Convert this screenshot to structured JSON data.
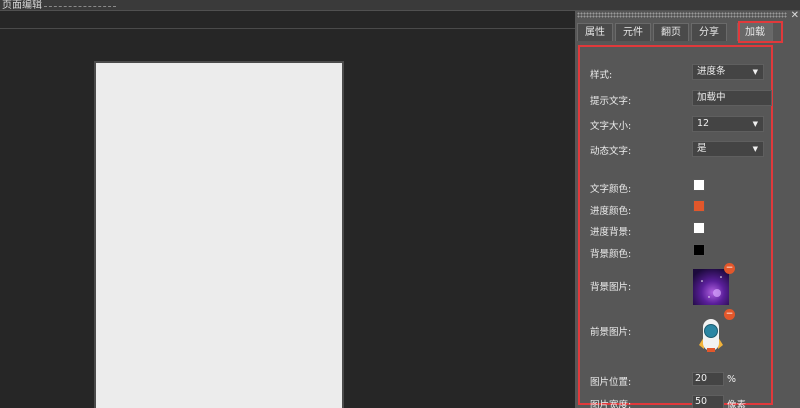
{
  "topbar": {
    "title": "页面编辑"
  },
  "panel": {
    "close_glyph": "✕",
    "tabs": [
      {
        "label": "属性",
        "active": false
      },
      {
        "label": "元件",
        "active": false
      },
      {
        "label": "翻页",
        "active": false
      },
      {
        "label": "分享",
        "active": false
      },
      {
        "label": "加载",
        "active": true
      }
    ],
    "form": {
      "style": {
        "label": "样式:",
        "value": "进度条"
      },
      "hint_text": {
        "label": "提示文字:",
        "value": "加载中"
      },
      "font_size": {
        "label": "文字大小:",
        "value": "12"
      },
      "dynamic_text": {
        "label": "动态文字:",
        "value": "是"
      },
      "text_color": {
        "label": "文字颜色:",
        "color": "#ffffff"
      },
      "progress_color": {
        "label": "进度颜色:",
        "color": "#e2572b"
      },
      "progress_bg": {
        "label": "进度背景:",
        "color": "#ffffff"
      },
      "bg_color": {
        "label": "背景颜色:",
        "color": "#000000"
      },
      "bg_image": {
        "label": "背景图片:",
        "icon": "purple-galaxy-image"
      },
      "fg_image": {
        "label": "前景图片:",
        "icon": "rocket-image"
      },
      "image_position": {
        "label": "图片位置:",
        "value": "20",
        "unit": "%"
      },
      "image_width": {
        "label": "图片宽度:",
        "value": "50",
        "unit": "像素"
      }
    },
    "dropdown_arrow": "▼",
    "remove_glyph": "−"
  },
  "colors": {
    "highlight": "#e0393b",
    "accent": "#e2572b",
    "panel_bg": "#575757"
  }
}
